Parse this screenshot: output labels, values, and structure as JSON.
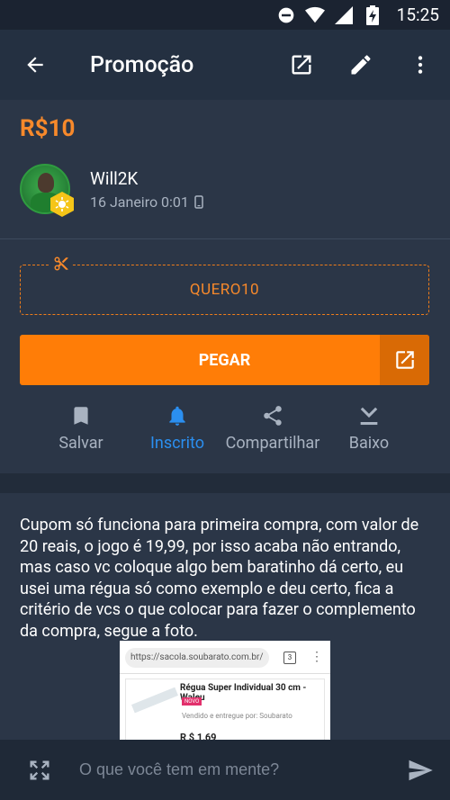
{
  "status_bar": {
    "time": "15:25"
  },
  "toolbar": {
    "title": "Promoção"
  },
  "deal": {
    "price": "R$10",
    "author": {
      "name": "Will2K",
      "date": "16 Janeiro 0:01"
    },
    "coupon_code": "QUERO10",
    "get_label": "PEGAR"
  },
  "actions": [
    {
      "label": "Salvar",
      "icon": "bookmark-icon",
      "active": false
    },
    {
      "label": "Inscrito",
      "icon": "bell-icon",
      "active": true
    },
    {
      "label": "Compartilhar",
      "icon": "share-icon",
      "active": false
    },
    {
      "label": "Baixo",
      "icon": "chevron-down-icon",
      "active": false
    }
  ],
  "body": {
    "text": "Cupom só funciona para primeira compra, com valor de 20 reais, o jogo é 19,99, por isso acaba não entrando, mas caso vc coloque algo bem baratinho dá certo, eu usei uma régua só como exemplo e deu certo, fica a critério de vcs o que colocar para fazer o complemento da compra, segue a foto.",
    "screenshot": {
      "url": "https://sacola.soubarato.com.br/",
      "tab_count": "3",
      "product_name": "Régua Super Individual 30 cm - Waleu",
      "badge": "NOVO",
      "seller": "Vendido e entregue por: Soubarato",
      "price": "R $ 1,69"
    }
  },
  "composer": {
    "placeholder": "O que você tem em mente?"
  },
  "colors": {
    "accent": "#ff7d07",
    "active_blue": "#2b8ff0",
    "background": "#2b3647"
  }
}
